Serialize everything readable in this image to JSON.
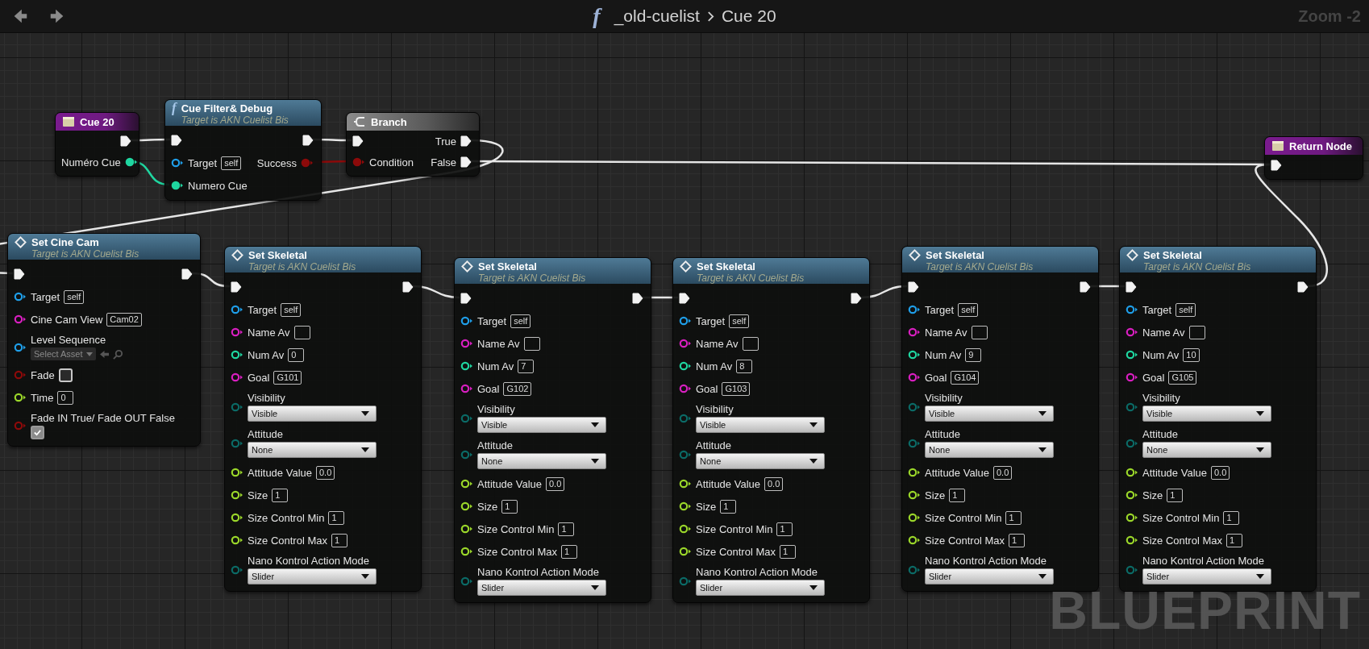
{
  "toolbar": {
    "icon_glyph": "f",
    "breadcrumb": [
      "_old-cuelist",
      "Cue 20"
    ],
    "zoom": "Zoom -2"
  },
  "nodes": [
    {
      "kind": "event",
      "title": "Cue 20",
      "rows": [
        {
          "kind": "inline",
          "right": {
            "kind": "exec"
          }
        },
        {
          "kind": "inline",
          "right": {
            "label": "Numéro Cue",
            "kind": "int",
            "connected": true
          }
        }
      ]
    },
    {
      "kind": "function",
      "icon_glyph": "f",
      "title": "Cue Filter& Debug",
      "subtitle": "Target is AKN Cuelist Bis",
      "rows": [
        {
          "kind": "inline",
          "left": {
            "kind": "exec"
          },
          "right": {
            "kind": "exec"
          }
        },
        {
          "kind": "inline",
          "left": {
            "label": "Target",
            "kind": "object",
            "connected": false,
            "field": {
              "kind": "text",
              "value": "self"
            }
          },
          "right": {
            "label": "Success",
            "kind": "bool",
            "connected": true
          }
        },
        {
          "kind": "inline",
          "left": {
            "label": "Numero Cue",
            "kind": "int",
            "connected": true
          }
        }
      ]
    },
    {
      "kind": "branch",
      "title": "Branch",
      "rows": [
        {
          "kind": "inline",
          "left": {
            "kind": "exec"
          },
          "right": {
            "label": "True",
            "kind": "exec"
          }
        },
        {
          "kind": "inline",
          "left": {
            "label": "Condition",
            "kind": "bool",
            "connected": true
          },
          "right": {
            "label": "False",
            "kind": "exec"
          }
        }
      ]
    },
    {
      "kind": "return",
      "title": "Return Node",
      "rows": [
        {
          "kind": "inline",
          "left": {
            "kind": "exec"
          }
        }
      ]
    },
    {
      "kind": "set",
      "title": "Set Cine Cam",
      "subtitle": "Target is AKN Cuelist Bis",
      "rows": [
        {
          "kind": "inline",
          "left": {
            "kind": "exec"
          },
          "right": {
            "kind": "exec"
          }
        },
        {
          "kind": "inline",
          "left": {
            "label": "Target",
            "kind": "object",
            "connected": false,
            "field": {
              "kind": "text",
              "value": "self"
            }
          }
        },
        {
          "kind": "inline",
          "left": {
            "label": "Cine Cam View",
            "kind": "name",
            "connected": false,
            "field": {
              "kind": "text",
              "value": "Cam02"
            }
          }
        },
        {
          "kind": "stacked",
          "left": {
            "label": "Level Sequence",
            "kind": "object",
            "connected": false,
            "field": {
              "kind": "asset",
              "placeholder": "Select Asset"
            }
          }
        },
        {
          "kind": "inline",
          "left": {
            "label": "Fade",
            "kind": "bool",
            "connected": false,
            "field": {
              "kind": "checkbox",
              "checked": false
            }
          }
        },
        {
          "kind": "inline",
          "left": {
            "label": "Time",
            "kind": "float",
            "connected": false,
            "field": {
              "kind": "text",
              "value": "0"
            }
          }
        },
        {
          "kind": "stacked",
          "left": {
            "label": "Fade IN True/ Fade OUT False",
            "kind": "bool",
            "connected": false,
            "field": {
              "kind": "checkbox",
              "checked": true
            }
          }
        }
      ]
    },
    {
      "kind": "set",
      "title": "Set Skeletal",
      "subtitle": "Target is AKN Cuelist Bis",
      "rows": [
        {
          "kind": "inline",
          "left": {
            "kind": "exec"
          },
          "right": {
            "kind": "exec"
          }
        },
        {
          "kind": "inline",
          "left": {
            "label": "Target",
            "kind": "object",
            "connected": false,
            "field": {
              "kind": "text",
              "value": "self"
            }
          }
        },
        {
          "kind": "inline",
          "left": {
            "label": "Name Av",
            "kind": "name",
            "connected": false,
            "field": {
              "kind": "text"
            }
          }
        },
        {
          "kind": "inline",
          "left": {
            "label": "Num Av",
            "kind": "int",
            "connected": false,
            "field": {
              "kind": "text",
              "value": "0"
            }
          }
        },
        {
          "kind": "inline",
          "left": {
            "label": "Goal",
            "kind": "name",
            "connected": false,
            "field": {
              "kind": "text",
              "value": "G101"
            }
          }
        },
        {
          "kind": "stacked",
          "left": {
            "label": "Visibility",
            "kind": "enum",
            "connected": false,
            "field": {
              "kind": "dropdown",
              "value": "Visible"
            }
          }
        },
        {
          "kind": "stacked",
          "left": {
            "label": "Attitude",
            "kind": "enum",
            "connected": false,
            "field": {
              "kind": "dropdown",
              "value": "None"
            }
          }
        },
        {
          "kind": "inline",
          "left": {
            "label": "Attitude Value",
            "kind": "float",
            "connected": false,
            "field": {
              "kind": "text",
              "value": "0.0"
            }
          }
        },
        {
          "kind": "inline",
          "left": {
            "label": "Size",
            "kind": "float",
            "connected": false,
            "field": {
              "kind": "text",
              "value": "1"
            }
          }
        },
        {
          "kind": "inline",
          "left": {
            "label": "Size Control Min",
            "kind": "float",
            "connected": false,
            "field": {
              "kind": "text",
              "value": "1"
            }
          }
        },
        {
          "kind": "inline",
          "left": {
            "label": "Size Control Max",
            "kind": "float",
            "connected": false,
            "field": {
              "kind": "text",
              "value": "1"
            }
          }
        },
        {
          "kind": "stacked",
          "left": {
            "label": "Nano Kontrol Action Mode",
            "kind": "enum",
            "connected": false,
            "field": {
              "kind": "dropdown",
              "value": "Slider"
            }
          }
        }
      ]
    },
    {
      "kind": "set",
      "title": "Set Skeletal",
      "subtitle": "Target is AKN Cuelist Bis",
      "rows": [
        {
          "kind": "inline",
          "left": {
            "kind": "exec"
          },
          "right": {
            "kind": "exec"
          }
        },
        {
          "kind": "inline",
          "left": {
            "label": "Target",
            "kind": "object",
            "connected": false,
            "field": {
              "kind": "text",
              "value": "self"
            }
          }
        },
        {
          "kind": "inline",
          "left": {
            "label": "Name Av",
            "kind": "name",
            "connected": false,
            "field": {
              "kind": "text"
            }
          }
        },
        {
          "kind": "inline",
          "left": {
            "label": "Num Av",
            "kind": "int",
            "connected": false,
            "field": {
              "kind": "text",
              "value": "7"
            }
          }
        },
        {
          "kind": "inline",
          "left": {
            "label": "Goal",
            "kind": "name",
            "connected": false,
            "field": {
              "kind": "text",
              "value": "G102"
            }
          }
        },
        {
          "kind": "stacked",
          "left": {
            "label": "Visibility",
            "kind": "enum",
            "connected": false,
            "field": {
              "kind": "dropdown",
              "value": "Visible"
            }
          }
        },
        {
          "kind": "stacked",
          "left": {
            "label": "Attitude",
            "kind": "enum",
            "connected": false,
            "field": {
              "kind": "dropdown",
              "value": "None"
            }
          }
        },
        {
          "kind": "inline",
          "left": {
            "label": "Attitude Value",
            "kind": "float",
            "connected": false,
            "field": {
              "kind": "text",
              "value": "0.0"
            }
          }
        },
        {
          "kind": "inline",
          "left": {
            "label": "Size",
            "kind": "float",
            "connected": false,
            "field": {
              "kind": "text",
              "value": "1"
            }
          }
        },
        {
          "kind": "inline",
          "left": {
            "label": "Size Control Min",
            "kind": "float",
            "connected": false,
            "field": {
              "kind": "text",
              "value": "1"
            }
          }
        },
        {
          "kind": "inline",
          "left": {
            "label": "Size Control Max",
            "kind": "float",
            "connected": false,
            "field": {
              "kind": "text",
              "value": "1"
            }
          }
        },
        {
          "kind": "stacked",
          "left": {
            "label": "Nano Kontrol Action Mode",
            "kind": "enum",
            "connected": false,
            "field": {
              "kind": "dropdown",
              "value": "Slider"
            }
          }
        }
      ]
    },
    {
      "kind": "set",
      "title": "Set Skeletal",
      "subtitle": "Target is AKN Cuelist Bis",
      "rows": [
        {
          "kind": "inline",
          "left": {
            "kind": "exec"
          },
          "right": {
            "kind": "exec"
          }
        },
        {
          "kind": "inline",
          "left": {
            "label": "Target",
            "kind": "object",
            "connected": false,
            "field": {
              "kind": "text",
              "value": "self"
            }
          }
        },
        {
          "kind": "inline",
          "left": {
            "label": "Name Av",
            "kind": "name",
            "connected": false,
            "field": {
              "kind": "text"
            }
          }
        },
        {
          "kind": "inline",
          "left": {
            "label": "Num Av",
            "kind": "int",
            "connected": false,
            "field": {
              "kind": "text",
              "value": "8"
            }
          }
        },
        {
          "kind": "inline",
          "left": {
            "label": "Goal",
            "kind": "name",
            "connected": false,
            "field": {
              "kind": "text",
              "value": "G103"
            }
          }
        },
        {
          "kind": "stacked",
          "left": {
            "label": "Visibility",
            "kind": "enum",
            "connected": false,
            "field": {
              "kind": "dropdown",
              "value": "Visible"
            }
          }
        },
        {
          "kind": "stacked",
          "left": {
            "label": "Attitude",
            "kind": "enum",
            "connected": false,
            "field": {
              "kind": "dropdown",
              "value": "None"
            }
          }
        },
        {
          "kind": "inline",
          "left": {
            "label": "Attitude Value",
            "kind": "float",
            "connected": false,
            "field": {
              "kind": "text",
              "value": "0.0"
            }
          }
        },
        {
          "kind": "inline",
          "left": {
            "label": "Size",
            "kind": "float",
            "connected": false,
            "field": {
              "kind": "text",
              "value": "1"
            }
          }
        },
        {
          "kind": "inline",
          "left": {
            "label": "Size Control Min",
            "kind": "float",
            "connected": false,
            "field": {
              "kind": "text",
              "value": "1"
            }
          }
        },
        {
          "kind": "inline",
          "left": {
            "label": "Size Control Max",
            "kind": "float",
            "connected": false,
            "field": {
              "kind": "text",
              "value": "1"
            }
          }
        },
        {
          "kind": "stacked",
          "left": {
            "label": "Nano Kontrol Action Mode",
            "kind": "enum",
            "connected": false,
            "field": {
              "kind": "dropdown",
              "value": "Slider"
            }
          }
        }
      ]
    },
    {
      "kind": "set",
      "title": "Set Skeletal",
      "subtitle": "Target is AKN Cuelist Bis",
      "rows": [
        {
          "kind": "inline",
          "left": {
            "kind": "exec"
          },
          "right": {
            "kind": "exec"
          }
        },
        {
          "kind": "inline",
          "left": {
            "label": "Target",
            "kind": "object",
            "connected": false,
            "field": {
              "kind": "text",
              "value": "self"
            }
          }
        },
        {
          "kind": "inline",
          "left": {
            "label": "Name Av",
            "kind": "name",
            "connected": false,
            "field": {
              "kind": "text"
            }
          }
        },
        {
          "kind": "inline",
          "left": {
            "label": "Num Av",
            "kind": "int",
            "connected": false,
            "field": {
              "kind": "text",
              "value": "9"
            }
          }
        },
        {
          "kind": "inline",
          "left": {
            "label": "Goal",
            "kind": "name",
            "connected": false,
            "field": {
              "kind": "text",
              "value": "G104"
            }
          }
        },
        {
          "kind": "stacked",
          "left": {
            "label": "Visibility",
            "kind": "enum",
            "connected": false,
            "field": {
              "kind": "dropdown",
              "value": "Visible"
            }
          }
        },
        {
          "kind": "stacked",
          "left": {
            "label": "Attitude",
            "kind": "enum",
            "connected": false,
            "field": {
              "kind": "dropdown",
              "value": "None"
            }
          }
        },
        {
          "kind": "inline",
          "left": {
            "label": "Attitude Value",
            "kind": "float",
            "connected": false,
            "field": {
              "kind": "text",
              "value": "0.0"
            }
          }
        },
        {
          "kind": "inline",
          "left": {
            "label": "Size",
            "kind": "float",
            "connected": false,
            "field": {
              "kind": "text",
              "value": "1"
            }
          }
        },
        {
          "kind": "inline",
          "left": {
            "label": "Size Control Min",
            "kind": "float",
            "connected": false,
            "field": {
              "kind": "text",
              "value": "1"
            }
          }
        },
        {
          "kind": "inline",
          "left": {
            "label": "Size Control Max",
            "kind": "float",
            "connected": false,
            "field": {
              "kind": "text",
              "value": "1"
            }
          }
        },
        {
          "kind": "stacked",
          "left": {
            "label": "Nano Kontrol Action Mode",
            "kind": "enum",
            "connected": false,
            "field": {
              "kind": "dropdown",
              "value": "Slider"
            }
          }
        }
      ]
    },
    {
      "kind": "set",
      "title": "Set Skeletal",
      "subtitle": "Target is AKN Cuelist Bis",
      "rows": [
        {
          "kind": "inline",
          "left": {
            "kind": "exec"
          },
          "right": {
            "kind": "exec"
          }
        },
        {
          "kind": "inline",
          "left": {
            "label": "Target",
            "kind": "object",
            "connected": false,
            "field": {
              "kind": "text",
              "value": "self"
            }
          }
        },
        {
          "kind": "inline",
          "left": {
            "label": "Name Av",
            "kind": "name",
            "connected": false,
            "field": {
              "kind": "text"
            }
          }
        },
        {
          "kind": "inline",
          "left": {
            "label": "Num Av",
            "kind": "int",
            "connected": false,
            "field": {
              "kind": "text",
              "value": "10"
            }
          }
        },
        {
          "kind": "inline",
          "left": {
            "label": "Goal",
            "kind": "name",
            "connected": false,
            "field": {
              "kind": "text",
              "value": "G105"
            }
          }
        },
        {
          "kind": "stacked",
          "left": {
            "label": "Visibility",
            "kind": "enum",
            "connected": false,
            "field": {
              "kind": "dropdown",
              "value": "Visible"
            }
          }
        },
        {
          "kind": "stacked",
          "left": {
            "label": "Attitude",
            "kind": "enum",
            "connected": false,
            "field": {
              "kind": "dropdown",
              "value": "None"
            }
          }
        },
        {
          "kind": "inline",
          "left": {
            "label": "Attitude Value",
            "kind": "float",
            "connected": false,
            "field": {
              "kind": "text",
              "value": "0.0"
            }
          }
        },
        {
          "kind": "inline",
          "left": {
            "label": "Size",
            "kind": "float",
            "connected": false,
            "field": {
              "kind": "text",
              "value": "1"
            }
          }
        },
        {
          "kind": "inline",
          "left": {
            "label": "Size Control Min",
            "kind": "float",
            "connected": false,
            "field": {
              "kind": "text",
              "value": "1"
            }
          }
        },
        {
          "kind": "inline",
          "left": {
            "label": "Size Control Max",
            "kind": "float",
            "connected": false,
            "field": {
              "kind": "text",
              "value": "1"
            }
          }
        },
        {
          "kind": "stacked",
          "left": {
            "label": "Nano Kontrol Action Mode",
            "kind": "enum",
            "connected": false,
            "field": {
              "kind": "dropdown",
              "value": "Slider"
            }
          }
        }
      ]
    }
  ],
  "watermark_label": "BLUEPRINT"
}
